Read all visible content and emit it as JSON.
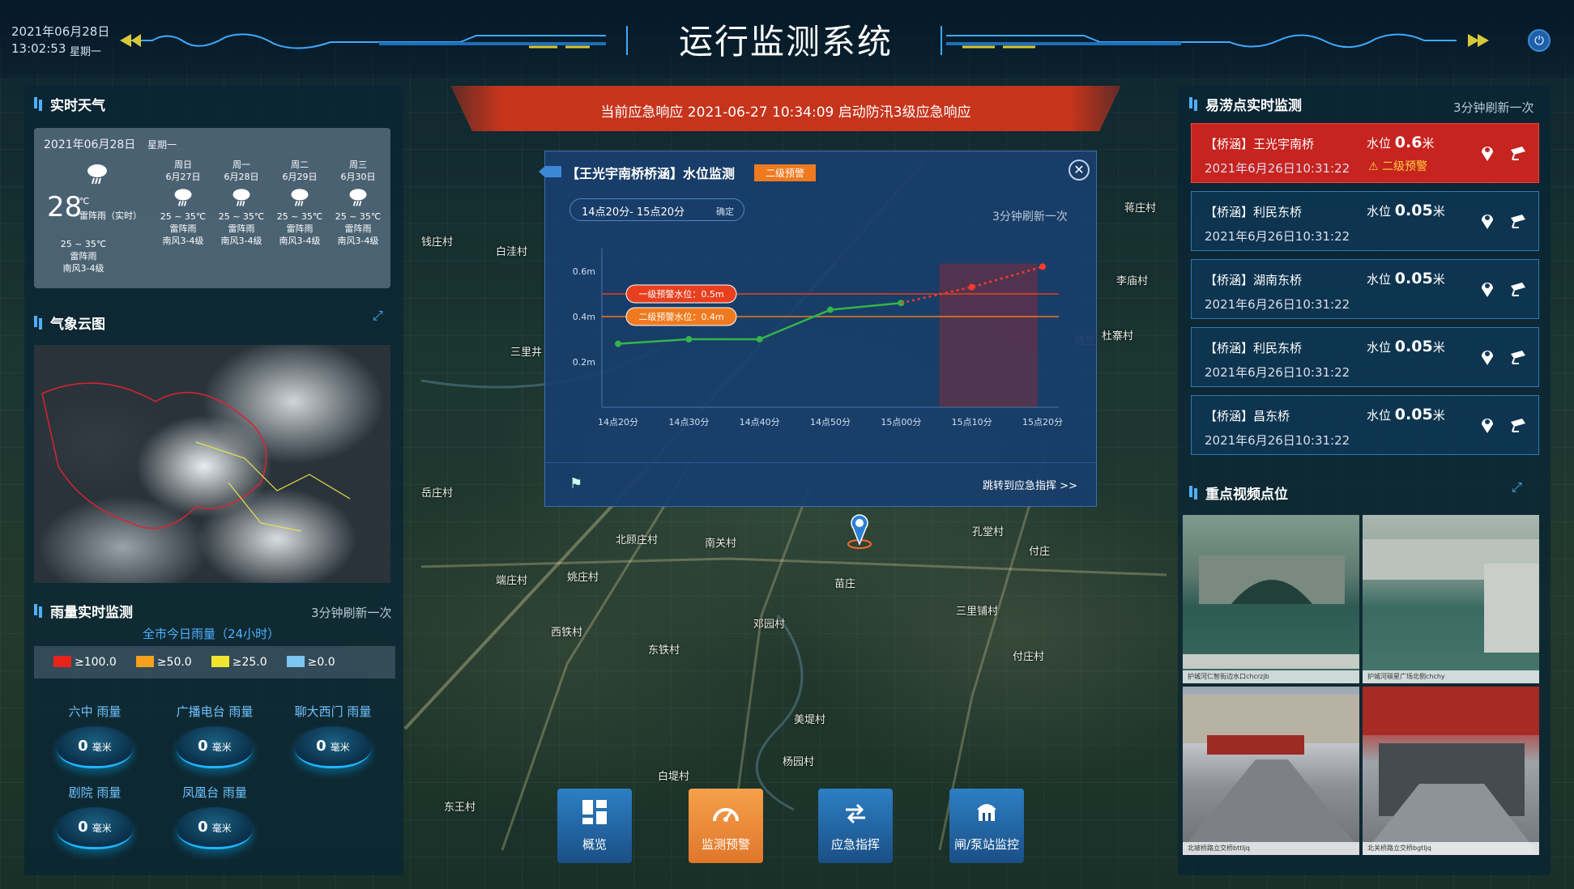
{
  "header": {
    "date": "2021年06月28日",
    "time": "13:02:53",
    "weekday": "星期一",
    "title": "运行监测系统"
  },
  "alert": {
    "text": "当前应急响应  2021-06-27 10:34:09  启动防汛3级应急响应"
  },
  "weather": {
    "section_title": "实时天气",
    "date": "2021年06月28日",
    "weekday": "星期一",
    "temp": "28",
    "unit": "℃",
    "condition_now": "雷阵雨（实时）",
    "range": "25 ~ 35℃",
    "cond": "雷阵雨",
    "wind": "南风3-4级",
    "forecast": [
      {
        "day": "周日",
        "date": "6月27日",
        "range": "25 ~ 35℃",
        "cond": "雷阵雨",
        "wind": "南风3-4级"
      },
      {
        "day": "周一",
        "date": "6月28日",
        "range": "25 ~ 35℃",
        "cond": "雷阵雨",
        "wind": "南风3-4级"
      },
      {
        "day": "周二",
        "date": "6月29日",
        "range": "25 ~ 35℃",
        "cond": "雷阵雨",
        "wind": "南风3-4级"
      },
      {
        "day": "周三",
        "date": "6月30日",
        "range": "25 ~ 35℃",
        "cond": "雷阵雨",
        "wind": "南风3-4级"
      }
    ]
  },
  "cloud": {
    "section_title": "气象云图"
  },
  "rain": {
    "section_title": "雨量实时监测",
    "refresh": "3分钟刷新一次",
    "subtitle": "全市今日雨量（24小时）",
    "legend": [
      {
        "label": "≥100.0",
        "color": "#e8231c"
      },
      {
        "label": "≥50.0",
        "color": "#f5a11c"
      },
      {
        "label": "≥25.0",
        "color": "#f2e530"
      },
      {
        "label": "≥0.0",
        "color": "#7cc6f2"
      }
    ],
    "stations": [
      {
        "name": "六中 雨量",
        "value": "0",
        "unit": "毫米"
      },
      {
        "name": "广播电台 雨量",
        "value": "0",
        "unit": "毫米"
      },
      {
        "name": "聊大西门 雨量",
        "value": "0",
        "unit": "毫米"
      },
      {
        "name": "剧院 雨量",
        "value": "0",
        "unit": "毫米"
      },
      {
        "name": "凤凰台 雨量",
        "value": "0",
        "unit": "毫米"
      }
    ]
  },
  "popup": {
    "title": "【王光宇南桥桥涵】水位监测",
    "badge": "二级预警",
    "time_range": "14点20分- 15点20分",
    "confirm": "确定",
    "refresh": "3分钟刷新一次",
    "jump": "跳转到应急指挥 >>"
  },
  "chart_data": {
    "type": "line",
    "x": [
      "14点20分",
      "14点30分",
      "14点40分",
      "14点50分",
      "15点00分",
      "15点10分",
      "15点20分"
    ],
    "yticks": [
      "0.2m",
      "0.4m",
      "0.6m"
    ],
    "ylim": [
      0,
      0.7
    ],
    "series": [
      {
        "values": [
          [
            0,
            0.28
          ],
          [
            1,
            0.3
          ],
          [
            2,
            0.3
          ],
          [
            3,
            0.43
          ],
          [
            4,
            0.46
          ]
        ],
        "color": "#33b54a"
      },
      {
        "values": [
          [
            4,
            0.46
          ],
          [
            5,
            0.53
          ],
          [
            6,
            0.62
          ]
        ],
        "color": "#ff3a2a",
        "dashed": true
      }
    ],
    "thresholds": [
      {
        "label": "一级预警水位：0.5m",
        "value": 0.5,
        "color": "#e8401f"
      },
      {
        "label": "二级预警水位：0.4m",
        "value": 0.4,
        "color": "#f07a1f"
      }
    ],
    "forecast_zone": [
      5,
      6
    ]
  },
  "map_labels": [
    "钱庄村",
    "白洼村",
    "三里井",
    "岳庄村",
    "北顾庄村",
    "南关村",
    "端庄村",
    "姚庄村",
    "西铁村",
    "东铁村",
    "邓园村",
    "美堤村",
    "杨园村",
    "白堤村",
    "东王村",
    "孔堂村",
    "三里铺村",
    "付庄村",
    "李庙村",
    "蒋庄村",
    "杜寨村",
    "付庄",
    "苗庄",
    "路里"
  ],
  "nav": [
    {
      "label": "概览"
    },
    {
      "label": "监测预警"
    },
    {
      "label": "应急指挥"
    },
    {
      "label": "闸/泵站监控"
    }
  ],
  "waterlog": {
    "section_title": "易涝点实时监测",
    "refresh": "3分钟刷新一次",
    "items": [
      {
        "name": "【桥涵】王光宇南桥",
        "level_label": "水位",
        "level": "0.6",
        "level_unit": "米",
        "time": "2021年6月26日10:31:22",
        "warning": "二级预警"
      },
      {
        "name": "【桥涵】利民东桥",
        "level_label": "水位",
        "level": "0.05",
        "level_unit": "米",
        "time": "2021年6月26日10:31:22"
      },
      {
        "name": "【桥涵】湖南东桥",
        "level_label": "水位",
        "level": "0.05",
        "level_unit": "米",
        "time": "2021年6月26日10:31:22"
      },
      {
        "name": "【桥涵】利民东桥",
        "level_label": "水位",
        "level": "0.05",
        "level_unit": "米",
        "time": "2021年6月26日10:31:22"
      },
      {
        "name": "【桥涵】昌东桥",
        "level_label": "水位",
        "level": "0.05",
        "level_unit": "米",
        "time": "2021年6月26日10:31:22"
      }
    ]
  },
  "video": {
    "section_title": "重点视频点位",
    "feeds": [
      {
        "caption": "护城河仁智街边水口chcrzjb"
      },
      {
        "caption": "护城河碳星广场北侧chchy"
      },
      {
        "caption": "北坡桥路立交桥bttljq"
      },
      {
        "caption": "北关桥路立交桥bgtljq"
      }
    ]
  }
}
